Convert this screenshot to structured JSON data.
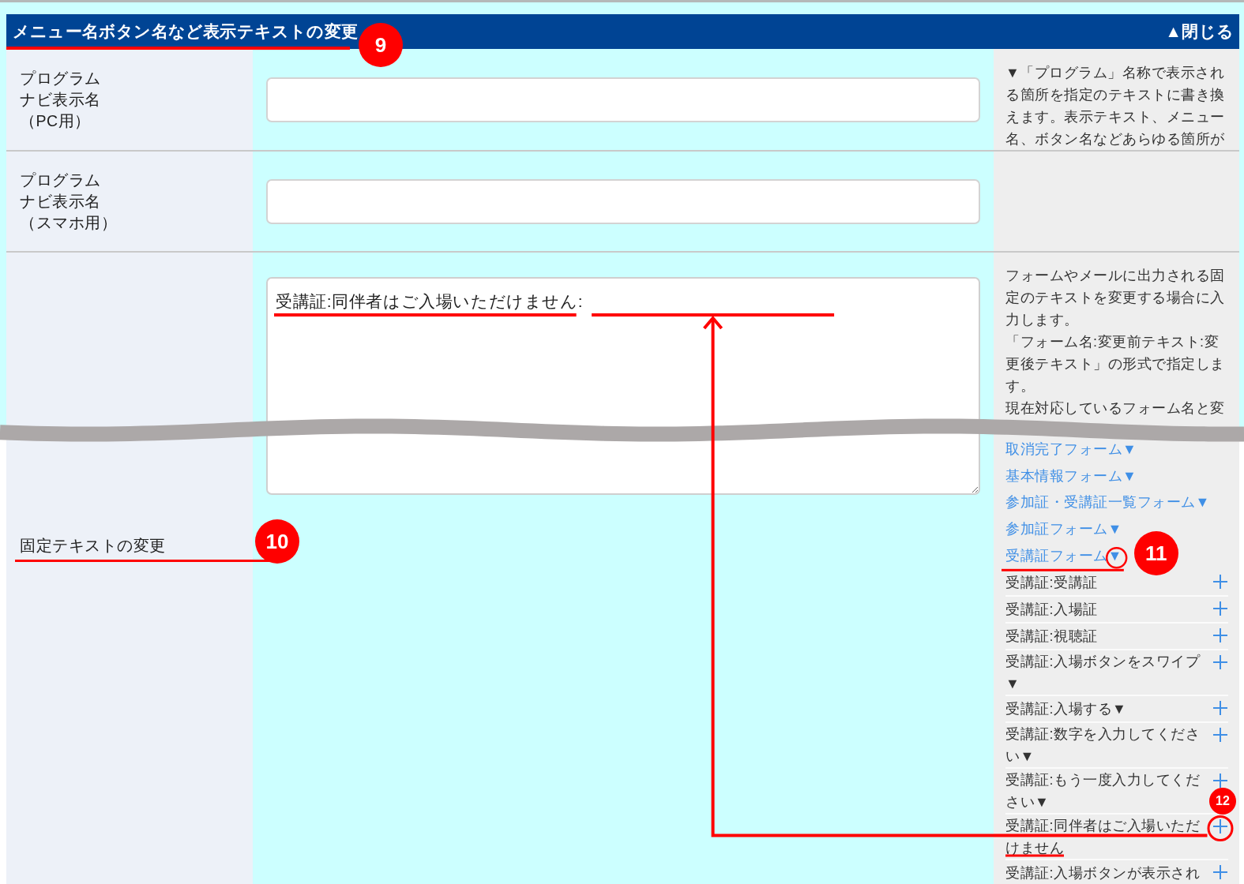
{
  "panel": {
    "title": "メニュー名ボタン名など表示テキストの変更",
    "underlined": true,
    "callout": "9",
    "close_button": "▲閉じる"
  },
  "rows": [
    {
      "kind": "input",
      "label_lines": [
        "プログラム",
        "ナビ表示名",
        "（PC用）"
      ],
      "underlined": false,
      "help": [
        "▼「プログラム」名称で表示される箇所を指定のテキストに書き換えます。表示テキスト、メニュー名、ボタン名などあらゆる箇所が"
      ]
    },
    {
      "kind": "input",
      "label_lines": [
        "プログラム",
        "ナビ表示名",
        "（スマホ用）"
      ],
      "underlined": false
    },
    {
      "kind": "textarea",
      "label_lines": [
        "固定テキストの変更"
      ],
      "underlined": true,
      "callout": "10",
      "value": "受講証:同伴者はご入場いただけません:",
      "value_underlined": true,
      "break_marker": true,
      "help": [
        "フォームやメールに出力される固定のテキストを変更する場合に入力します。",
        "「フォーム名:変更前テキスト:変更後テキスト」の形式で指定します。",
        "現在対応しているフォーム名と変"
      ],
      "forms": [
        {
          "label": "取消完了フォーム▼",
          "ringed": false,
          "underlined": false
        },
        {
          "label": "基本情報フォーム▼",
          "ringed": false,
          "underlined": false
        },
        {
          "label": "参加証・受講証一覧フォーム▼",
          "ringed": false,
          "underlined": false
        },
        {
          "label": "参加証フォーム▼",
          "ringed": false,
          "underlined": false
        },
        {
          "label": "受講証フォーム▼",
          "ringed": true,
          "underlined": true,
          "callout": "11",
          "items": [
            {
              "text": "受講証:受講証",
              "ringed": false,
              "underlined": false,
              "arrow_to_field": false
            },
            {
              "text": "受講証:入場証",
              "ringed": false,
              "underlined": false,
              "arrow_to_field": false
            },
            {
              "text": "受講証:視聴証",
              "ringed": false,
              "underlined": false,
              "arrow_to_field": false
            },
            {
              "text": "受講証:入場ボタンをスワイプ▼",
              "ringed": false,
              "underlined": false,
              "arrow_to_field": false
            },
            {
              "text": "受講証:入場する▼",
              "ringed": false,
              "underlined": false,
              "arrow_to_field": false
            },
            {
              "text": "受講証:数字を入力してください▼",
              "ringed": false,
              "underlined": false,
              "arrow_to_field": false
            },
            {
              "text": "受講証:もう一度入力してください▼",
              "ringed": false,
              "underlined": false,
              "arrow_to_field": false
            },
            {
              "text": "受講証:同伴者はご入場いただけません",
              "ringed": true,
              "underlined": true,
              "arrow_to_field": true,
              "callout": "12"
            },
            {
              "text": "受講証:入場ボタンが表示され",
              "ringed": false,
              "underlined": false,
              "arrow_to_field": false
            }
          ]
        }
      ]
    }
  ]
}
